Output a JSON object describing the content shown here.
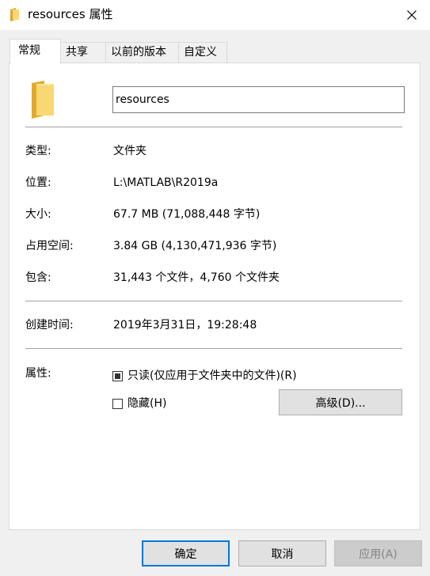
{
  "window": {
    "title": "resources 属性",
    "folder_color": "#f4c44c",
    "accent_color": "#0078d7"
  },
  "tabs": [
    {
      "label": "常规",
      "active": true
    },
    {
      "label": "共享",
      "active": false
    },
    {
      "label": "以前的版本",
      "active": false
    },
    {
      "label": "自定义",
      "active": false
    }
  ],
  "general": {
    "name_value": "resources",
    "type_label": "类型:",
    "type_value": "文件夹",
    "location_label": "位置:",
    "location_value": "L:\\MATLAB\\R2019a",
    "size_label": "大小:",
    "size_value": "67.7 MB (71,088,448 字节)",
    "disk_size_label": "占用空间:",
    "disk_size_value": "3.84 GB (4,130,471,936 字节)",
    "contains_label": "包含:",
    "contains_value": "31,443 个文件，4,760 个文件夹",
    "created_label": "创建时间:",
    "created_value": "2019年3月31日，19:28:48",
    "attributes_label": "属性:",
    "readonly_label": "只读(仅应用于文件夹中的文件)(R)",
    "readonly_state": "indeterminate",
    "hidden_label": "隐藏(H)",
    "hidden_state": "unchecked",
    "advanced_label": "高级(D)..."
  },
  "footer": {
    "ok_label": "确定",
    "cancel_label": "取消",
    "apply_label": "应用(A)"
  },
  "icons": {
    "title": "folder-icon",
    "close": "close-icon",
    "large": "folder-icon"
  }
}
